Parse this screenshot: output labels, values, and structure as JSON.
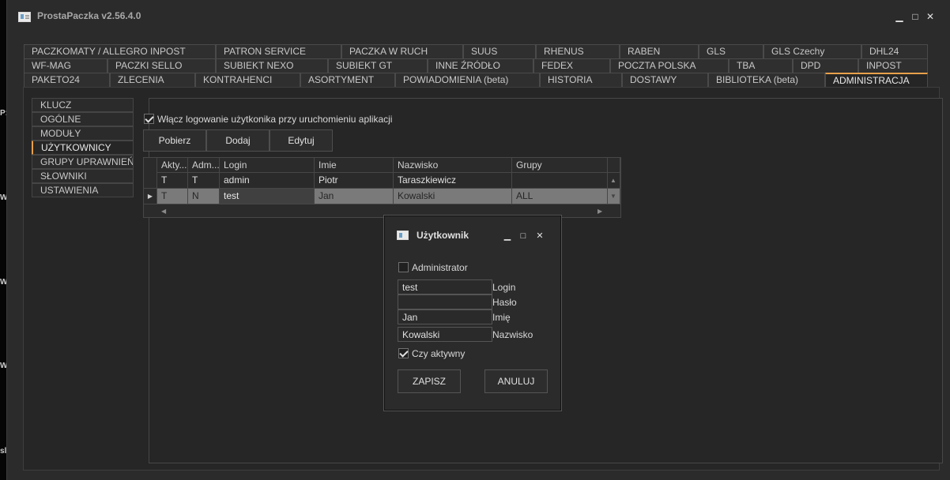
{
  "window": {
    "title": "ProstaPaczka v2.56.4.0"
  },
  "background_glyphs": [
    "P:",
    "W",
    "W",
    "W",
    "sl"
  ],
  "tabs": {
    "row1": [
      "PACZKOMATY / ALLEGRO INPOST",
      "PATRON SERVICE",
      "PACZKA W RUCH",
      "SUUS",
      "RHENUS",
      "RABEN",
      "GLS",
      "GLS Czechy",
      "DHL24"
    ],
    "row2": [
      "WF-MAG",
      "PACZKI SELLO",
      "SUBIEKT NEXO",
      "SUBIEKT GT",
      "INNE ŹRÓDŁO",
      "FEDEX",
      "POCZTA POLSKA",
      "TBA",
      "DPD",
      "INPOST"
    ],
    "row3": [
      "PAKETO24",
      "ZLECENIA",
      "KONTRAHENCI",
      "ASORTYMENT",
      "POWIADOMIENIA (beta)",
      "HISTORIA",
      "DOSTAWY",
      "BIBLIOTEKA (beta)",
      "ADMINISTRACJA"
    ],
    "active": "ADMINISTRACJA"
  },
  "sidebar": {
    "items": [
      "KLUCZ",
      "OGÓLNE",
      "MODUŁY",
      "UŻYTKOWNICY",
      "GRUPY UPRAWNIEŃ",
      "SŁOWNIKI",
      "USTAWIENIA"
    ],
    "active": "UŻYTKOWNICY"
  },
  "login_logging": {
    "label": "Włącz logowanie użytkonika przy uruchomieniu aplikacji",
    "checked": true
  },
  "toolbar": {
    "fetch": "Pobierz",
    "add": "Dodaj",
    "edit": "Edytuj"
  },
  "grid": {
    "columns": [
      "Akty...",
      "Adm...",
      "Login",
      "Imie",
      "Nazwisko",
      "Grupy"
    ],
    "rows": [
      {
        "active": "T",
        "admin": "T",
        "login": "admin",
        "first_name": "Piotr",
        "last_name": "Taraszkiewicz",
        "groups": ""
      },
      {
        "active": "T",
        "admin": "N",
        "login": "test",
        "first_name": "Jan",
        "last_name": "Kowalski",
        "groups": "ALL"
      }
    ],
    "selected_row": 1
  },
  "dialog": {
    "title": "Użytkownik",
    "administrator": {
      "label": "Administrator",
      "checked": false
    },
    "login": {
      "value": "test",
      "label": "Login"
    },
    "password": {
      "value": "",
      "label": "Hasło"
    },
    "first_name": {
      "value": "Jan",
      "label": "Imię"
    },
    "last_name": {
      "value": "Kowalski",
      "label": "Nazwisko"
    },
    "active": {
      "label": "Czy aktywny",
      "checked": true
    },
    "save": "ZAPISZ",
    "cancel": "ANULUJ"
  },
  "colors": {
    "accent": "#e8a04a",
    "window_bg": "#2b2b2b",
    "selected_row": "#7a7a7a"
  }
}
